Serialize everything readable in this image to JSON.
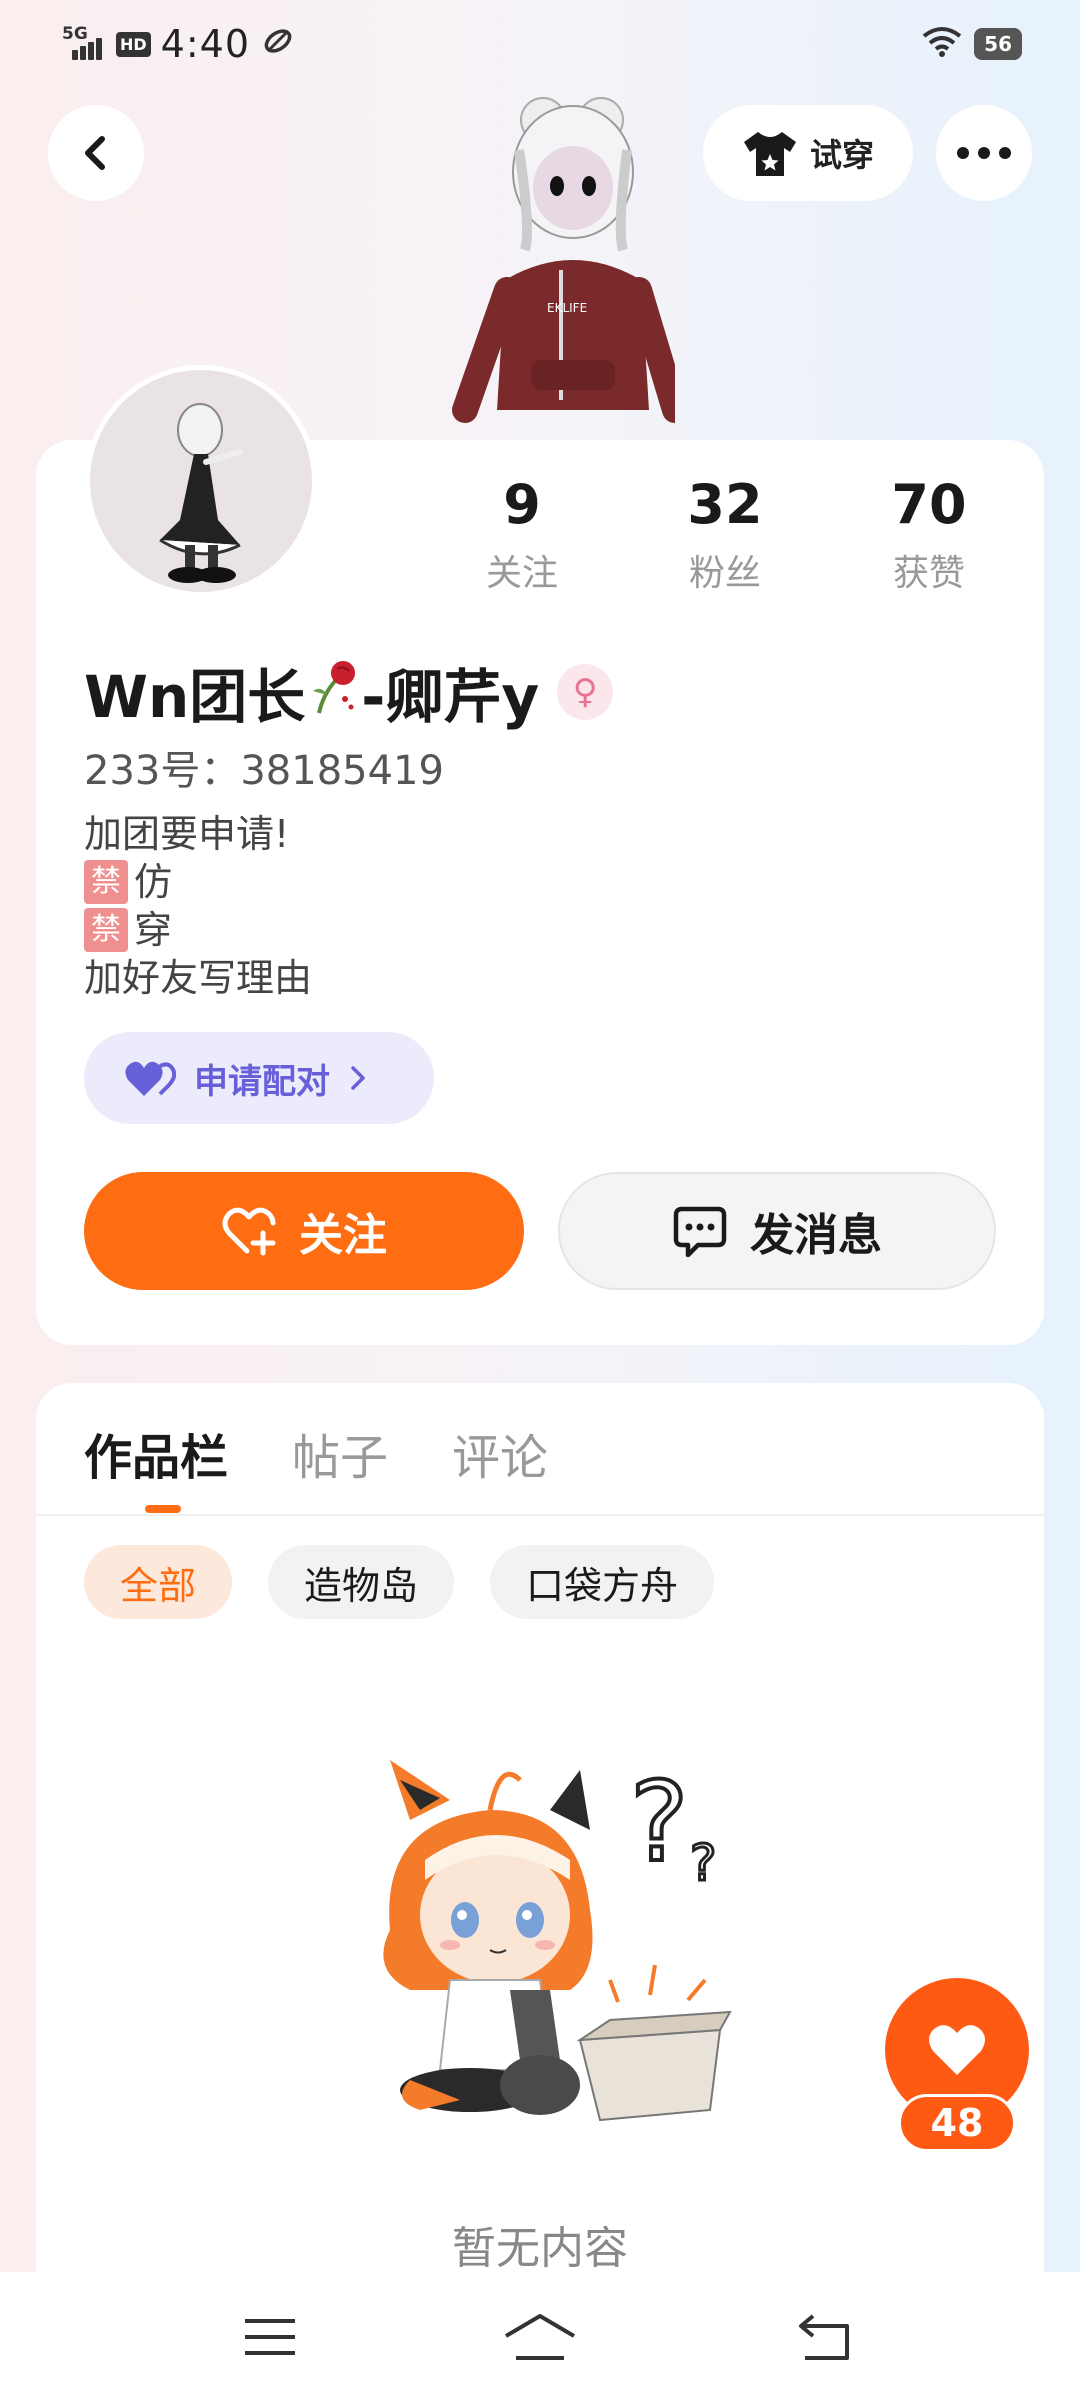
{
  "status_bar": {
    "network": "5G",
    "hd": "HD",
    "time": "4:40",
    "battery": "56"
  },
  "header": {
    "tryon_label": "试穿"
  },
  "profile": {
    "username_part1": "Wn团长",
    "username_part2": "-卿芹y",
    "gender": "♀",
    "account_id": "233号：38185419",
    "stats": [
      {
        "value": "9",
        "label": "关注"
      },
      {
        "value": "32",
        "label": "粉丝"
      },
      {
        "value": "70",
        "label": "获赞"
      }
    ],
    "bio": {
      "line1": "加团要申请!",
      "ban_tag": "禁",
      "line2_text": "仿",
      "line3_text": "穿",
      "line4": "加好友写理由"
    },
    "pair_button": "申请配对",
    "follow_button": "关注",
    "message_button": "发消息"
  },
  "content": {
    "tabs": [
      "作品栏",
      "帖子",
      "评论"
    ],
    "filters": [
      "全部",
      "造物岛",
      "口袋方舟"
    ],
    "empty_text": "暂无内容"
  },
  "floating": {
    "like_count": "48"
  },
  "colors": {
    "accent": "#ff6d12",
    "pair_purple": "#6860d8"
  }
}
